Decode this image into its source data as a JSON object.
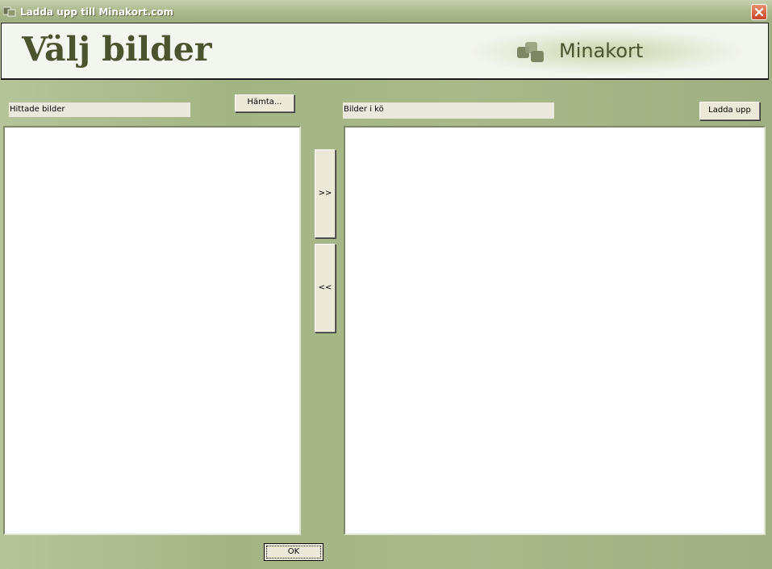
{
  "window": {
    "title": "Ladda upp till Minakort.com"
  },
  "banner": {
    "heading": "Välj bilder",
    "logo_text": "Minakort"
  },
  "left_panel": {
    "label": "Hittade bilder",
    "fetch_button": "Hämta..."
  },
  "right_panel": {
    "label": "Bilder i kö",
    "upload_button": "Ladda upp"
  },
  "transfer": {
    "add_label": ">>",
    "remove_label": "<<"
  },
  "footer": {
    "ok_label": "OK"
  },
  "colors": {
    "accent": "#4a5530",
    "frame": "#a9b98a",
    "button_face": "#ece9d8"
  }
}
